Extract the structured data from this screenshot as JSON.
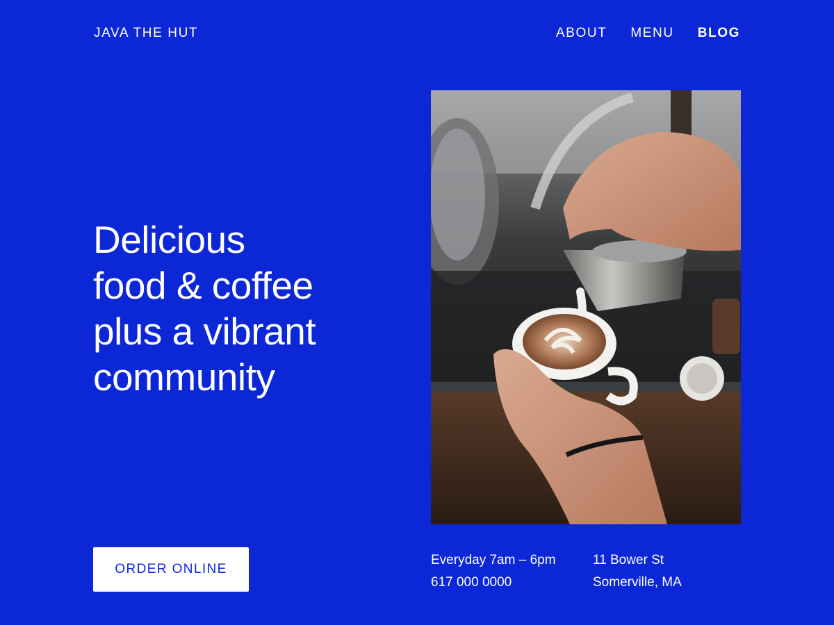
{
  "header": {
    "brand": "JAVA THE HUT",
    "nav": [
      {
        "label": "ABOUT"
      },
      {
        "label": "MENU"
      },
      {
        "label": "BLOG"
      }
    ]
  },
  "hero": {
    "headline_lines": [
      "Delicious",
      "food & coffee",
      "plus a vibrant",
      "community"
    ],
    "cta_label": "ORDER ONLINE"
  },
  "info": {
    "hours": "Everyday 7am – 6pm",
    "phone": "617 000 0000",
    "street": "11 Bower St",
    "city": "Somerville, MA"
  },
  "colors": {
    "background": "#0b27d6",
    "text": "#ffffff",
    "button_bg": "#ffffff",
    "button_text": "#0b27d6"
  },
  "image": {
    "subject": "barista-pouring-latte-art-photo"
  }
}
